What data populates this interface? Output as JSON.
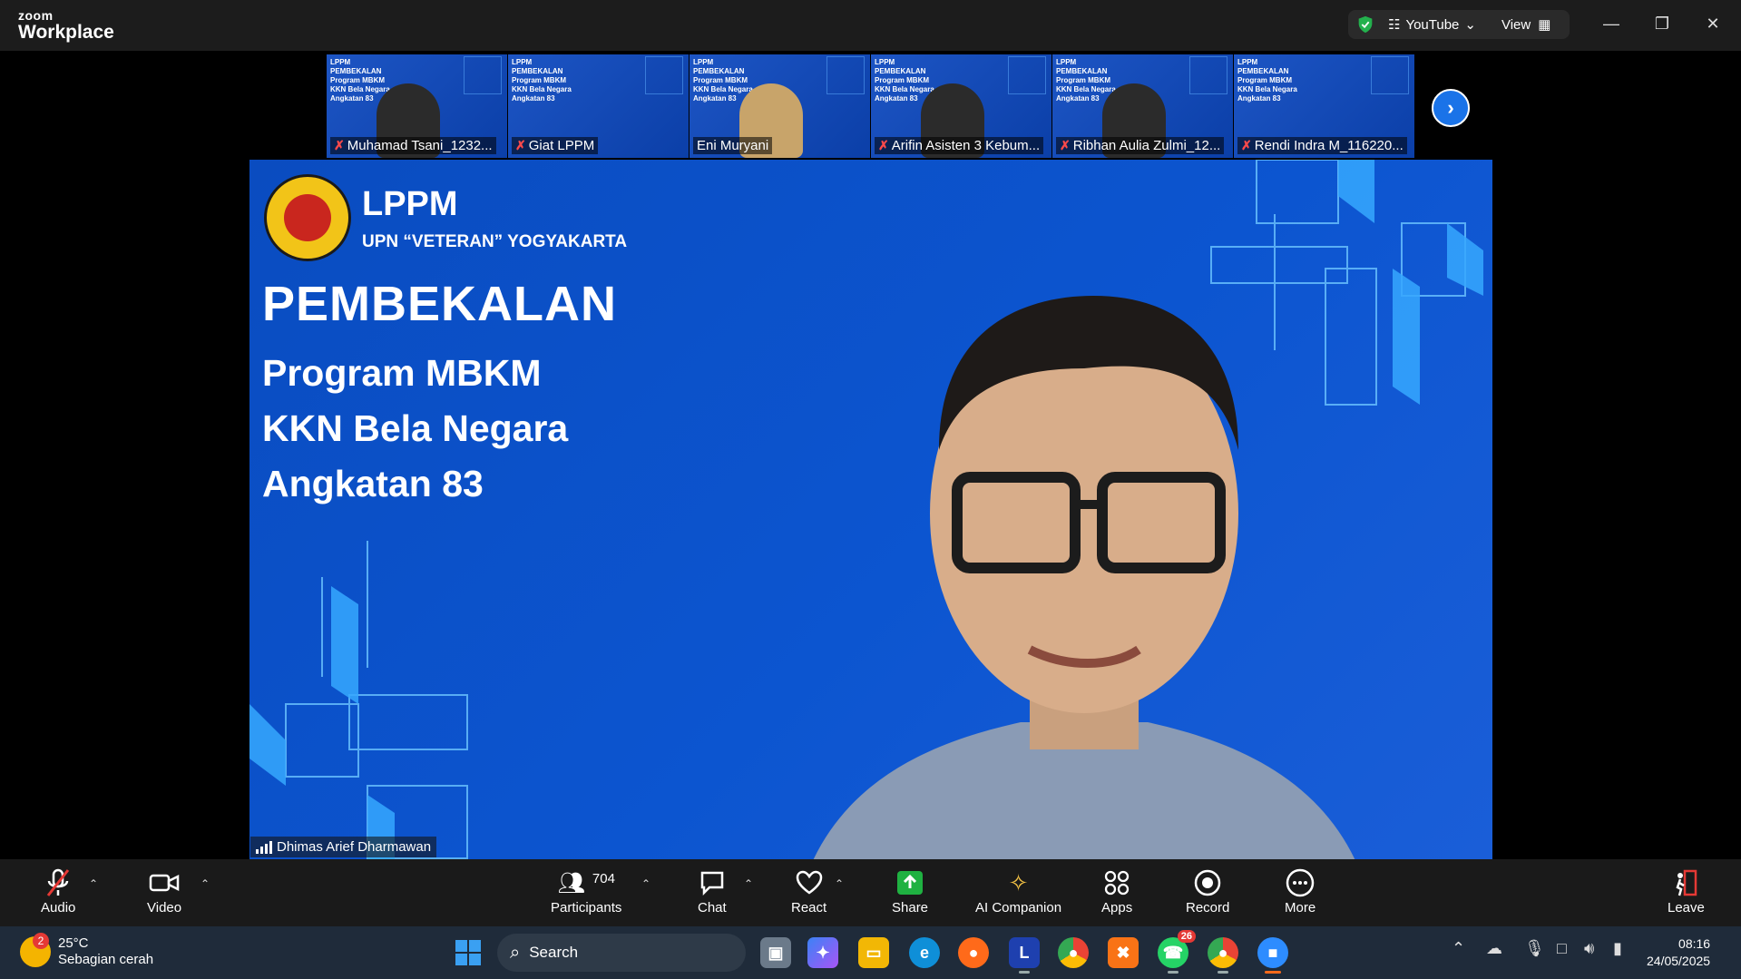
{
  "app": {
    "brand_top": "zoom",
    "brand_bottom": "Workplace"
  },
  "titlebar": {
    "stream_label": "YouTube",
    "view_label": "View"
  },
  "participants_strip": [
    {
      "name": "Muhamad Tsani_1232...",
      "muted": true
    },
    {
      "name": "Giat LPPM",
      "muted": true
    },
    {
      "name": "Eni Muryani",
      "muted": false
    },
    {
      "name": "Arifin Asisten 3 Kebum...",
      "muted": true
    },
    {
      "name": "Ribhan Aulia Zulmi_12...",
      "muted": true
    },
    {
      "name": "Rendi Indra M_116220...",
      "muted": true
    }
  ],
  "tile_slide_text": {
    "l1": "LPPM",
    "l2": "PEMBEKALAN",
    "l3": "Program MBKM",
    "l4": "KKN Bela Negara",
    "l5": "Angkatan 83"
  },
  "slide": {
    "org": "LPPM",
    "university": "UPN “VETERAN” YOGYAKARTA",
    "heading": "PEMBEKALAN",
    "line1": "Program MBKM",
    "line2": "KKN Bela Negara",
    "line3": "Angkatan 83"
  },
  "active_speaker": {
    "name": "Dhimas Arief Dharmawan"
  },
  "toolbar": {
    "audio": "Audio",
    "video": "Video",
    "participants": "Participants",
    "participants_count": "704",
    "chat": "Chat",
    "react": "React",
    "share": "Share",
    "ai_companion": "AI Companion",
    "apps": "Apps",
    "record": "Record",
    "more": "More",
    "leave": "Leave"
  },
  "taskbar": {
    "weather_badge": "2",
    "temperature": "25°C",
    "condition": "Sebagian cerah",
    "search_label": "Search",
    "whatsapp_badge": "26",
    "time": "08:16",
    "date": "24/05/2025"
  },
  "colors": {
    "accent": "#1a73e8",
    "slide_blue": "#0c55d0",
    "share_green": "#1fb141",
    "leave_red": "#e53935"
  }
}
